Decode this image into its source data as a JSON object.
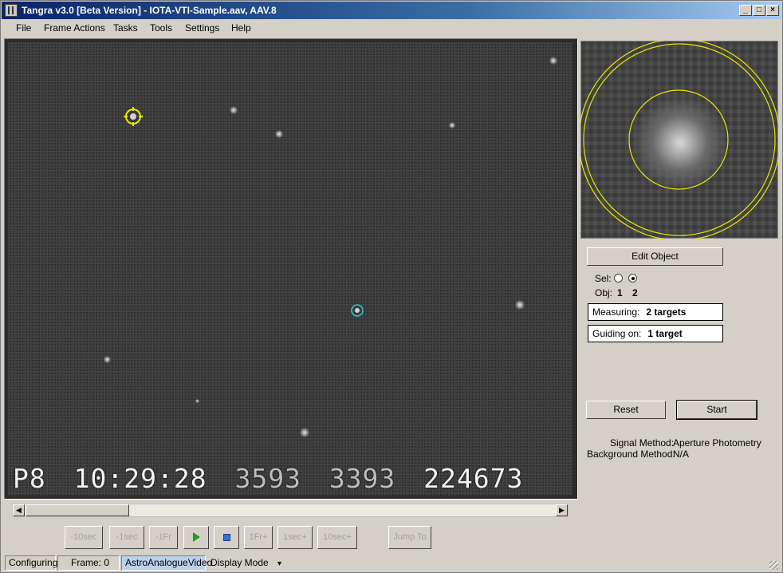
{
  "window": {
    "title": "Tangra v3.0 [Beta Version] - IOTA-VTI-Sample.aav, AAV.8",
    "controls": {
      "minimize": "_",
      "maximize": "□",
      "close": "×"
    }
  },
  "menu": {
    "file": "File",
    "frame_actions": "Frame Actions",
    "tasks": "Tasks",
    "tools": "Tools",
    "settings": "Settings",
    "help": "Help"
  },
  "video": {
    "osd": {
      "prefix": "P8",
      "time": "10:29:28",
      "field1": "3593",
      "field2": "3393",
      "field3": "224673"
    }
  },
  "scrollbar": {
    "left_arrow": "◀",
    "right_arrow": "▶"
  },
  "nav": {
    "minus_10sec": "-10sec",
    "minus_1sec": "-1sec",
    "minus_1fr": "-1Fr",
    "plus_1fr": "1Fr+",
    "plus_1sec": "1sec+",
    "plus_10sec": "10sec+",
    "jump_to": "Jump To"
  },
  "side": {
    "edit_object": "Edit Object",
    "sel_label": "Sel:",
    "obj_label": "Obj:",
    "obj_1": "1",
    "obj_2": "2",
    "measuring_label": "Measuring:",
    "measuring_value": "2 targets",
    "guiding_label": "Guiding on:",
    "guiding_value": "1 target",
    "reset": "Reset",
    "start": "Start",
    "signal_method_label": "Signal Method:",
    "signal_method_value": "Aperture Photometry",
    "background_method_label": "Background Method:",
    "background_method_value": "N/A"
  },
  "status": {
    "state": "Configuring",
    "frame": "Frame: 0",
    "video_type": "AstroAnalogueVideo",
    "display_mode": "Display Mode",
    "display_mode_arrow": "▾"
  },
  "colors": {
    "target1": "#e8e800",
    "target2": "#20d0d0",
    "title_gradient_start": "#0a246a",
    "zoom_ring": "#e8e800"
  }
}
